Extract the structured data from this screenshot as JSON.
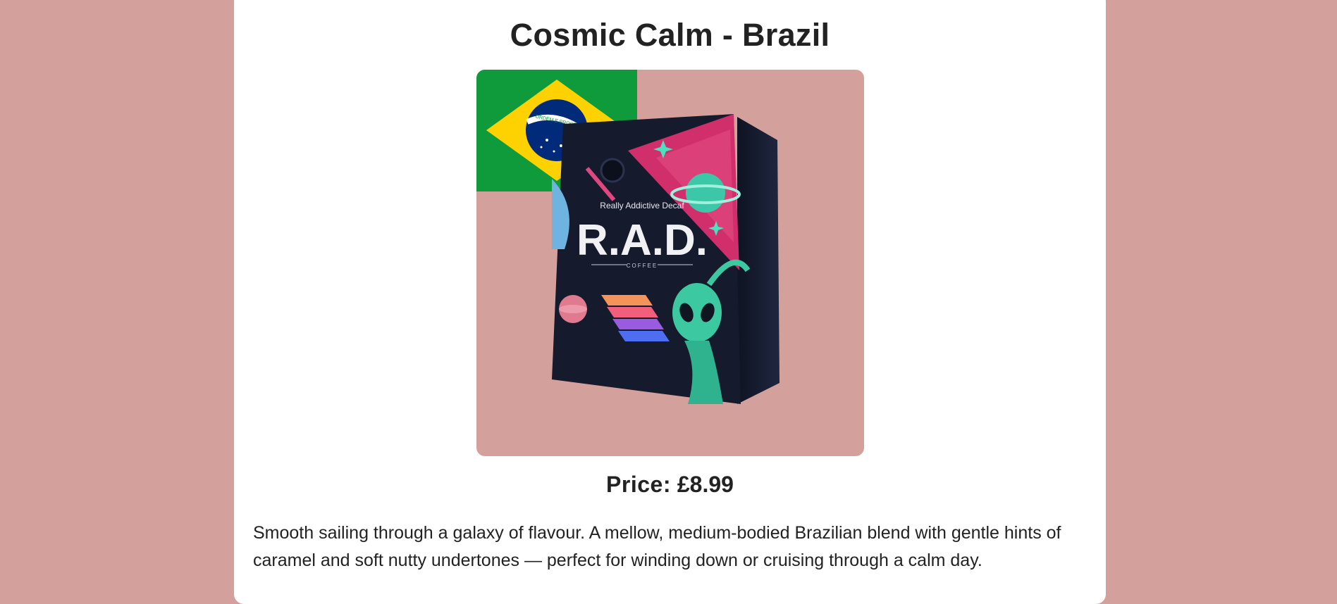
{
  "product": {
    "title": "Cosmic Calm - Brazil",
    "price_label": "Price:",
    "price_value": "£8.99",
    "description": "Smooth sailing through a galaxy of flavour. A mellow, medium-bodied Brazilian blend with gentle hints of caramel and soft nutty undertones — perfect for winding down or cruising through a calm day."
  },
  "bag_label": {
    "tagline": "Really Addictive Decaf",
    "brand": "R.A.D.",
    "sub": "COFFEE"
  },
  "flag": {
    "banner": "ORDEM E PROGRESSO"
  },
  "colors": {
    "page_background": "#d4a09c",
    "card_background": "#ffffff",
    "text": "#222222",
    "flag_green": "#0f9b3c",
    "flag_yellow": "#fed100",
    "flag_blue": "#012a7a",
    "bag_dark": "#151a2c"
  },
  "icons": [
    "brazil-flag-icon",
    "coffee-bag-image"
  ]
}
